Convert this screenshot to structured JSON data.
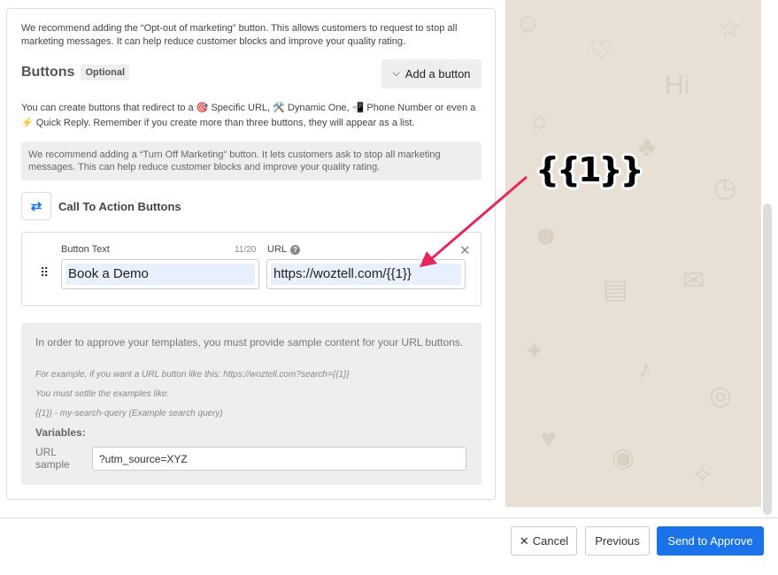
{
  "intro_text": "We recommend adding the “Opt-out of marketing” button. This allows customers to request to stop all marketing messages. It can help reduce customer blocks and improve your quality rating.",
  "buttons_section": {
    "title": "Buttons",
    "badge": "Optional",
    "add_button_label": "Add a button",
    "description": "You can create buttons that redirect to a 🎯 Specific URL, 🛠️ Dynamic One, 📲 Phone Number or even a ⚡ Quick Reply. Remember if you create more than three buttons, they will appear as a list.",
    "notice": "We recommend adding a “Turn Off Marketing” button. It lets customers ask to stop all marketing messages. This can help reduce customer blocks and improve your quality rating."
  },
  "cta": {
    "title": "Call To Action Buttons",
    "button_text_label": "Button Text",
    "button_text_counter": "11/20",
    "button_text_value": "Book a Demo",
    "url_label": "URL",
    "url_value": "https://woztell.com/{{1}}"
  },
  "sample": {
    "title": "In order to approve your templates, you must provide sample content for your URL buttons.",
    "example_1": "For example, if you want a URL button like this: https://woztell.com?search={{1}}",
    "example_2": "You must settle the examples like:",
    "example_3": "{{1}} - my-search-query (Example search query)",
    "variables_label": "Variables:",
    "url_sample_label": "URL sample",
    "url_sample_value": "?utm_source=XYZ"
  },
  "preview": {
    "placeholder_token": "{{1}}"
  },
  "footer": {
    "cancel_label": "Cancel",
    "previous_label": "Previous",
    "send_label": "Send to Approve"
  },
  "colors": {
    "accent": "#1a73e8",
    "annotation_arrow": "#e8265e",
    "preview_bg": "#e8e0d5"
  }
}
